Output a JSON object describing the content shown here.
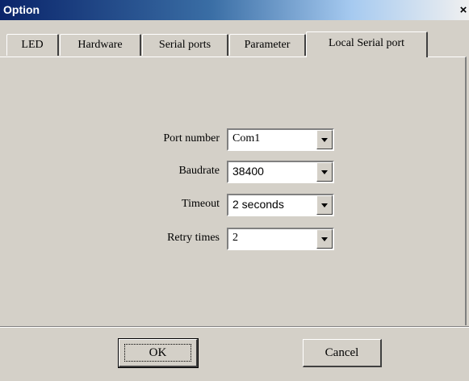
{
  "window": {
    "title": "Option",
    "close_label": "×"
  },
  "tabs": [
    {
      "label": "LED"
    },
    {
      "label": "Hardware"
    },
    {
      "label": "Serial ports"
    },
    {
      "label": "Parameter"
    },
    {
      "label": "Local Serial port",
      "active": true
    }
  ],
  "form": {
    "port_number": {
      "label": "Port number",
      "value": "Com1"
    },
    "baudrate": {
      "label": "Baudrate",
      "value": "38400"
    },
    "timeout": {
      "label": "Timeout",
      "value": "2 seconds"
    },
    "retry_times": {
      "label": "Retry times",
      "value": "2"
    }
  },
  "buttons": {
    "ok": "OK",
    "cancel": "Cancel"
  }
}
